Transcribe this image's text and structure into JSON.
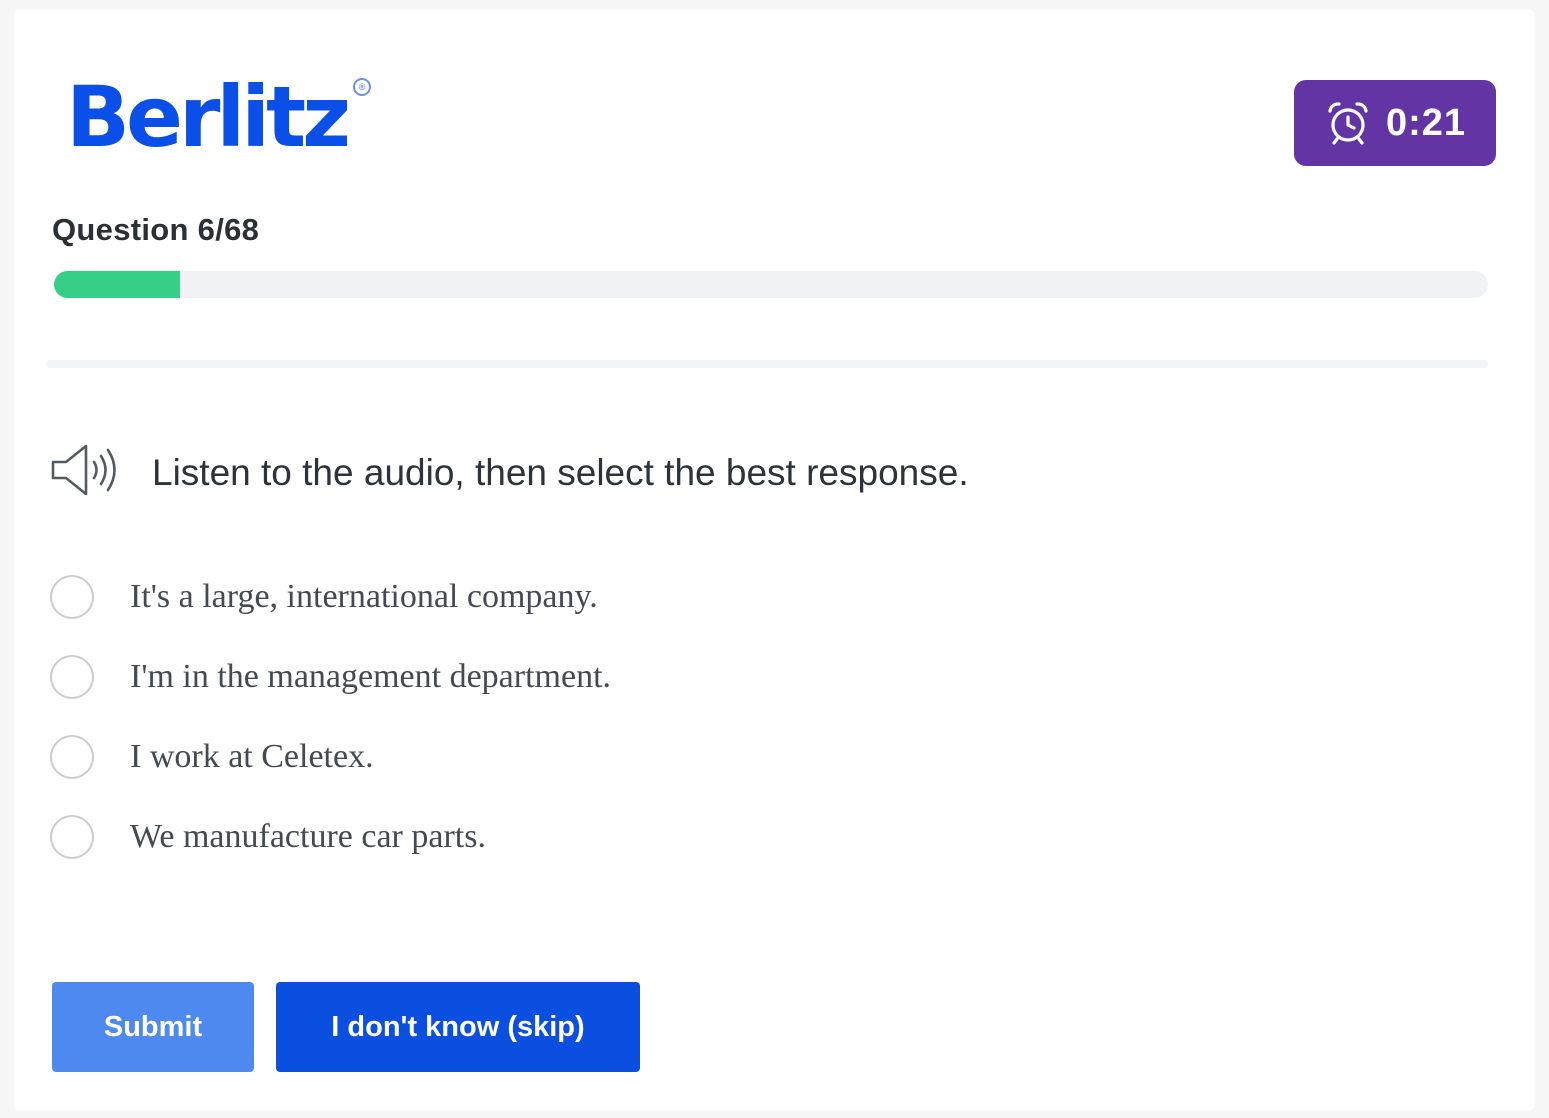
{
  "brand": {
    "name": "Berlitz",
    "registered_mark": "®"
  },
  "timer": {
    "icon": "alarm-clock-icon",
    "time": "0:21",
    "color": "#6234a4"
  },
  "question": {
    "counter": "Question 6/68",
    "current": 6,
    "total": 68,
    "progress_fraction": 0.0882,
    "progress_color": "#37cf88",
    "prompt_icon": "speaker-icon",
    "prompt": "Listen to the audio, then select the best response."
  },
  "options": [
    {
      "label": "It's a large, international company.",
      "selected": false
    },
    {
      "label": "I'm in the management department.",
      "selected": false
    },
    {
      "label": "I work at Celetex.",
      "selected": false
    },
    {
      "label": "We manufacture car parts.",
      "selected": false
    }
  ],
  "actions": {
    "submit_label": "Submit",
    "skip_label": "I don't know (skip)"
  },
  "colors": {
    "brand_blue": "#0a50e8",
    "submit_blue": "#4d89ee",
    "skip_blue": "#0a4fe0"
  }
}
